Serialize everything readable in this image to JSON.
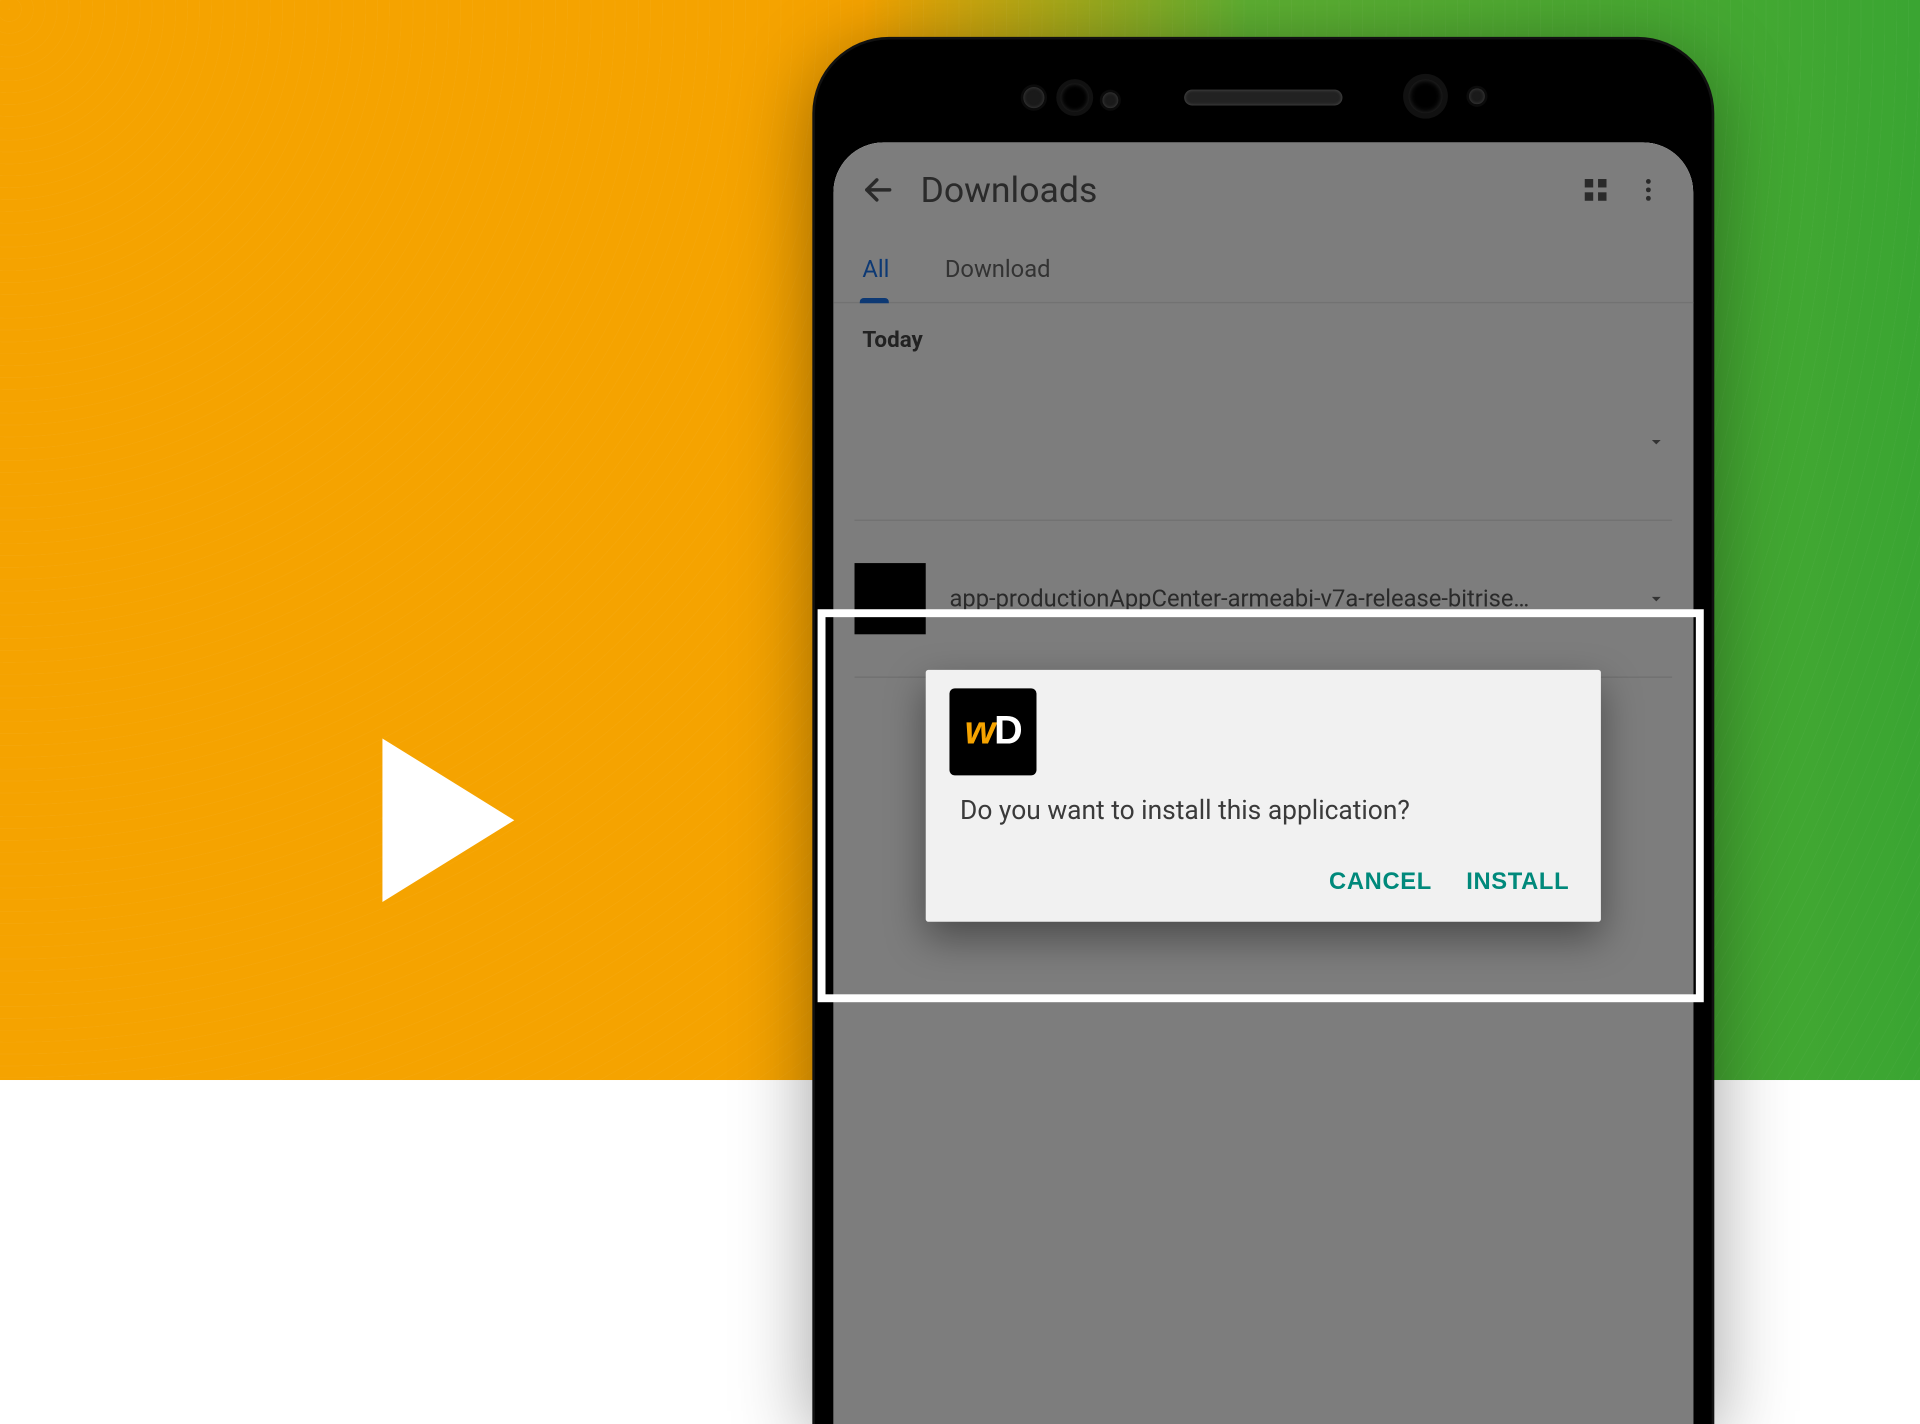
{
  "screen": {
    "title": "Downloads",
    "tabs": [
      {
        "label": "All",
        "active": true
      },
      {
        "label": "Download",
        "active": false
      }
    ],
    "section_label": "Today",
    "rows": [
      {
        "label": ""
      },
      {
        "label": "app-productionAppCenter-armeabi-v7a-release-bitrise…"
      }
    ]
  },
  "dialog": {
    "icon_text_a": "w",
    "icon_text_b": "D",
    "message": "Do you want to install this application?",
    "cancel": "CANCEL",
    "install": "INSTALL"
  },
  "icons": {
    "back": "←",
    "grid": "▦",
    "more": "⋮",
    "chevron_down": "▾"
  }
}
